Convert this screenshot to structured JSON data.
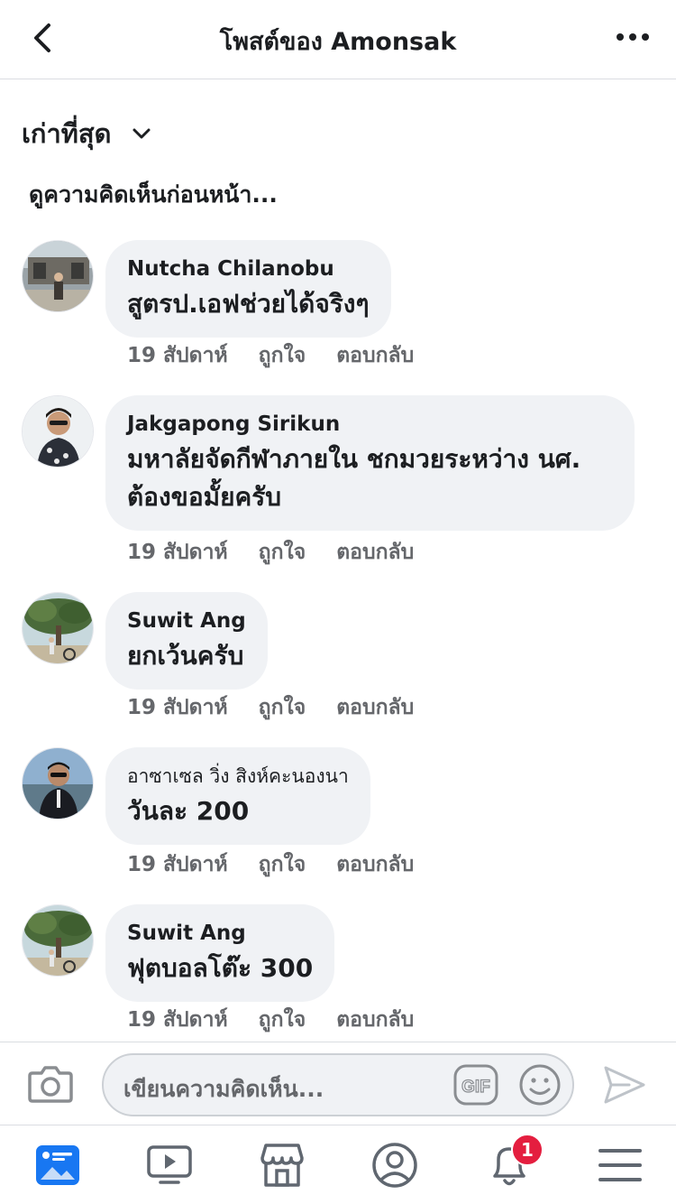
{
  "header": {
    "title": "โพสต์ของ Amonsak"
  },
  "sort": {
    "label": "เก่าที่สุด"
  },
  "view_previous": "ดูความคิดเห็นก่อนหน้า...",
  "comments": [
    {
      "author": "Nutcha Chilanobu",
      "lines": [
        "สูตรป.เอฟช่วยได้จริงๆ"
      ],
      "time": "19 สัปดาห์",
      "like": "ถูกใจ",
      "reply": "ตอบกลับ"
    },
    {
      "author": "Jakgapong Sirikun",
      "lines": [
        "มหาลัยจัดกีฬาภายใน ชกมวยระหว่าง นศ.",
        "ต้องขอมั้ยครับ"
      ],
      "time": "19 สัปดาห์",
      "like": "ถูกใจ",
      "reply": "ตอบกลับ"
    },
    {
      "author": "Suwit Ang",
      "lines": [
        "ยกเว้นครับ"
      ],
      "time": "19 สัปดาห์",
      "like": "ถูกใจ",
      "reply": "ตอบกลับ"
    },
    {
      "author": "อาซาเซล วิ่ง สิงห์คะนองนา",
      "lines": [
        "วันละ 200"
      ],
      "time": "19 สัปดาห์",
      "like": "ถูกใจ",
      "reply": "ตอบกลับ"
    },
    {
      "author": "Suwit Ang",
      "lines": [
        "ฟุตบอลโต๊ะ 300"
      ],
      "time": "19 สัปดาห์",
      "like": "ถูกใจ",
      "reply": "ตอบกลับ"
    }
  ],
  "composer": {
    "placeholder": "เขียนความคิดเห็น...",
    "gif_label": "GIF"
  },
  "tabbar": {
    "notifications_badge": "1"
  },
  "colors": {
    "accent": "#1877f2",
    "bubble": "#f0f2f5",
    "badge": "#e41e3f",
    "muted_text": "#65676b"
  },
  "icons": [
    "back-arrow-icon",
    "more-dots-icon",
    "chevron-down-icon",
    "camera-icon",
    "gif-icon",
    "smiley-icon",
    "send-icon",
    "news-feed-icon",
    "watch-icon",
    "marketplace-icon",
    "profile-icon",
    "bell-icon",
    "menu-icon"
  ]
}
